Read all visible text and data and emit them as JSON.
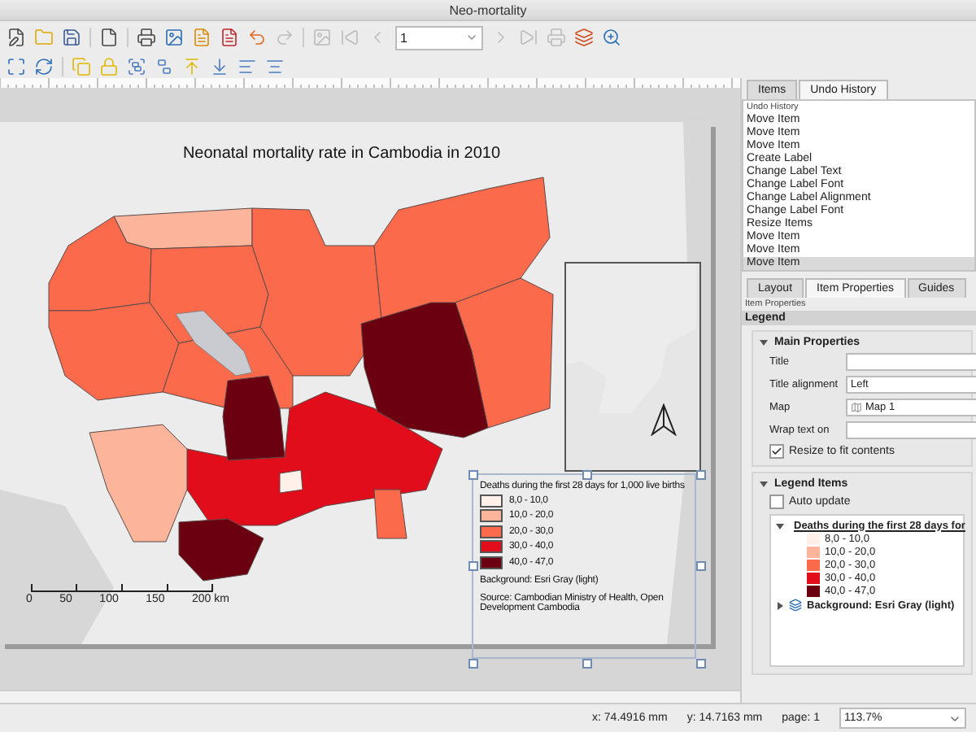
{
  "window": {
    "title": "Neo-mortality"
  },
  "toolbar": {
    "page_field": {
      "value": "1"
    }
  },
  "map": {
    "title": "Neonatal mortality rate in Cambodia in 2010",
    "legend": {
      "title": "Deaths during the first 28 days for 1,000 live births",
      "classes": [
        {
          "label": "8,0 - 10,0",
          "color": "#fff0e9"
        },
        {
          "label": "10,0 - 20,0",
          "color": "#fcb49a"
        },
        {
          "label": "20,0 - 30,0",
          "color": "#fb6a4a"
        },
        {
          "label": "30,0 - 40,0",
          "color": "#e20d1a"
        },
        {
          "label": "40,0 - 47,0",
          "color": "#6b0010"
        }
      ],
      "background": "Background: Esri Gray (light)",
      "source": "Source: Cambodian Ministry of Health, Open Development Cambodia"
    },
    "scale_bar": [
      "0",
      "50",
      "100",
      "150",
      "200 km"
    ]
  },
  "panel": {
    "top_tabs": [
      {
        "label": "Items",
        "selected": false
      },
      {
        "label": "Undo History",
        "selected": true
      }
    ],
    "undo_history": {
      "header": "Undo History",
      "items": [
        {
          "label": "Move Item",
          "selected": false
        },
        {
          "label": "Move Item",
          "selected": false
        },
        {
          "label": "Move Item",
          "selected": false
        },
        {
          "label": "Create Label",
          "selected": false
        },
        {
          "label": "Change Label Text",
          "selected": false
        },
        {
          "label": "Change Label Font",
          "selected": false
        },
        {
          "label": "Change Label Alignment",
          "selected": false
        },
        {
          "label": "Change Label Font",
          "selected": false
        },
        {
          "label": "Resize Items",
          "selected": false
        },
        {
          "label": "Move Item",
          "selected": false
        },
        {
          "label": "Move Item",
          "selected": false
        },
        {
          "label": "Move Item",
          "selected": true
        }
      ]
    },
    "bottom_tabs": [
      {
        "label": "Layout",
        "selected": false
      },
      {
        "label": "Item Properties",
        "selected": true
      },
      {
        "label": "Guides",
        "selected": false
      }
    ],
    "caption": "Item Properties",
    "item_type": "Legend",
    "main_properties": {
      "title": "Main Properties",
      "expanded": true,
      "fields": [
        {
          "kind": "text",
          "label": "Title"
        },
        {
          "kind": "combo",
          "label": "Title alignment",
          "value": "Left"
        },
        {
          "kind": "map",
          "label": "Map",
          "value": "Map 1"
        },
        {
          "kind": "text",
          "label": "Wrap text on"
        },
        {
          "kind": "checkbox",
          "label": "Resize to fit contents",
          "checked": true
        }
      ]
    },
    "legend_items": {
      "title": "Legend Items",
      "expanded": true,
      "auto_update": {
        "label": "Auto update",
        "checked": false
      },
      "tree": [
        {
          "label": "Deaths during the first 28 days for",
          "expanded": true,
          "children": [
            {
              "label": "8,0 - 10,0",
              "color": "#fff0e9"
            },
            {
              "label": "10,0 - 20,0",
              "color": "#fcb49a"
            },
            {
              "label": "20,0 - 30,0",
              "color": "#fb6a4a"
            },
            {
              "label": "30,0 - 40,0",
              "color": "#e20d1a"
            },
            {
              "label": "40,0 - 47,0",
              "color": "#6b0010"
            }
          ]
        },
        {
          "label": "Background: Esri Gray (light)",
          "expanded": false
        }
      ]
    }
  },
  "status_bar": {
    "x": "x: 74.4916 mm",
    "y": "y: 14.7163 mm",
    "page": "page: 1",
    "zoom": "113.7%"
  }
}
